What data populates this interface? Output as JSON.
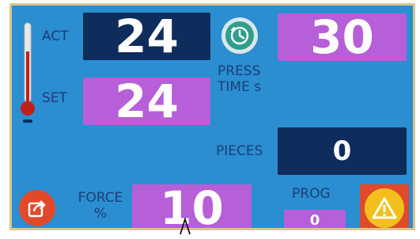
{
  "panel": {
    "act_label": "ACT",
    "act_value": "24",
    "set_label": "SET",
    "set_value": "24",
    "press_time_label_line1": "PRESS",
    "press_time_label_line2": "TIME s",
    "press_time_value": "30",
    "pieces_label": "PIECES",
    "pieces_value": "0",
    "force_label_line1": "FORCE",
    "force_label_line2": "%",
    "force_value": "10",
    "prog_label": "PROG",
    "prog_value": "0"
  },
  "icons": {
    "thermometer": "thermometer-icon",
    "clock": "clock-icon",
    "export": "export-icon",
    "warning": "warning-icon"
  },
  "colors": {
    "background": "#2a8ed1",
    "navy_field": "#0e2c5c",
    "purple_field": "#b65fd9",
    "frame": "#d8c68d",
    "label_text": "#1c3e78",
    "value_text": "#ffffff",
    "export_button": "#e04a2a",
    "warning_button": "#f3c01b",
    "clock_button": "#2f9e8d"
  }
}
